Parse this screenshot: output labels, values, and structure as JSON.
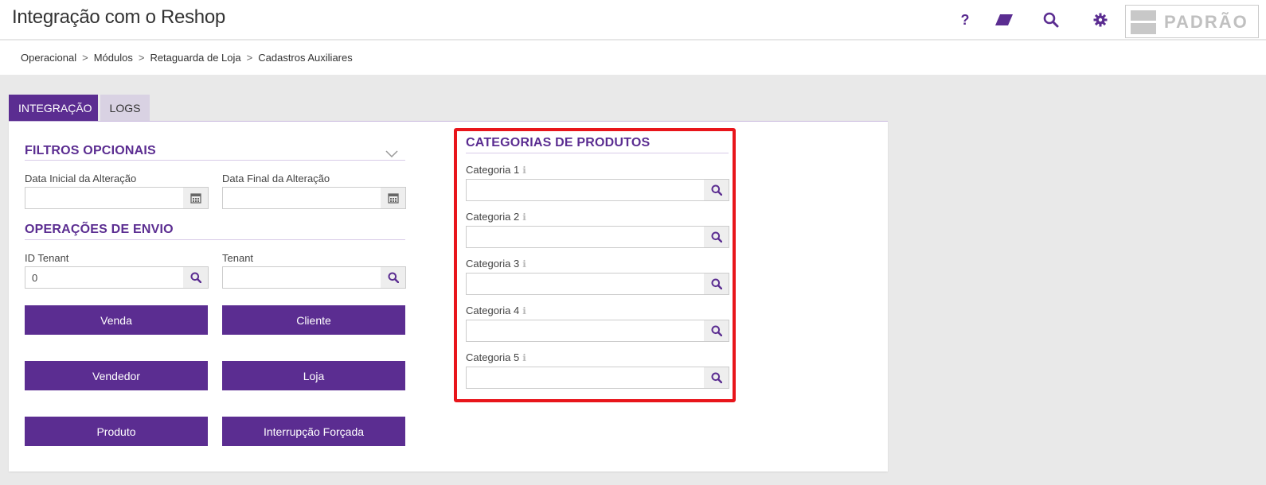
{
  "header": {
    "title": "Integração com o Reshop",
    "icons": [
      "help-icon",
      "eraser-icon",
      "search-icon",
      "gear-icon"
    ],
    "help_glyph": "?",
    "logo_text": "PADRÃO"
  },
  "breadcrumb": [
    "Operacional",
    "Módulos",
    "Retaguarda de Loja",
    "Cadastros Auxiliares"
  ],
  "breadcrumb_separator": ">",
  "tabs": [
    {
      "label": "INTEGRAÇÃO",
      "active": true
    },
    {
      "label": "LOGS",
      "active": false
    }
  ],
  "filters": {
    "title": "FILTROS OPCIONAIS",
    "start_date_label": "Data Inicial da Alteração",
    "start_date_value": "",
    "end_date_label": "Data Final da Alteração",
    "end_date_value": ""
  },
  "operations": {
    "title": "OPERAÇÕES DE ENVIO",
    "id_tenant_label": "ID Tenant",
    "id_tenant_value": "0",
    "tenant_label": "Tenant",
    "tenant_value": "",
    "buttons": [
      "Venda",
      "Cliente",
      "Vendedor",
      "Loja",
      "Produto",
      "Interrupção Forçada"
    ]
  },
  "categories": {
    "title": "CATEGORIAS DE PRODUTOS",
    "items": [
      {
        "label": "Categoria 1",
        "value": ""
      },
      {
        "label": "Categoria 2",
        "value": ""
      },
      {
        "label": "Categoria 3",
        "value": ""
      },
      {
        "label": "Categoria 4",
        "value": ""
      },
      {
        "label": "Categoria 5",
        "value": ""
      }
    ],
    "info_glyph": "ℹ"
  },
  "colors": {
    "accent": "#5b2d91",
    "highlight": "#e8151b"
  }
}
